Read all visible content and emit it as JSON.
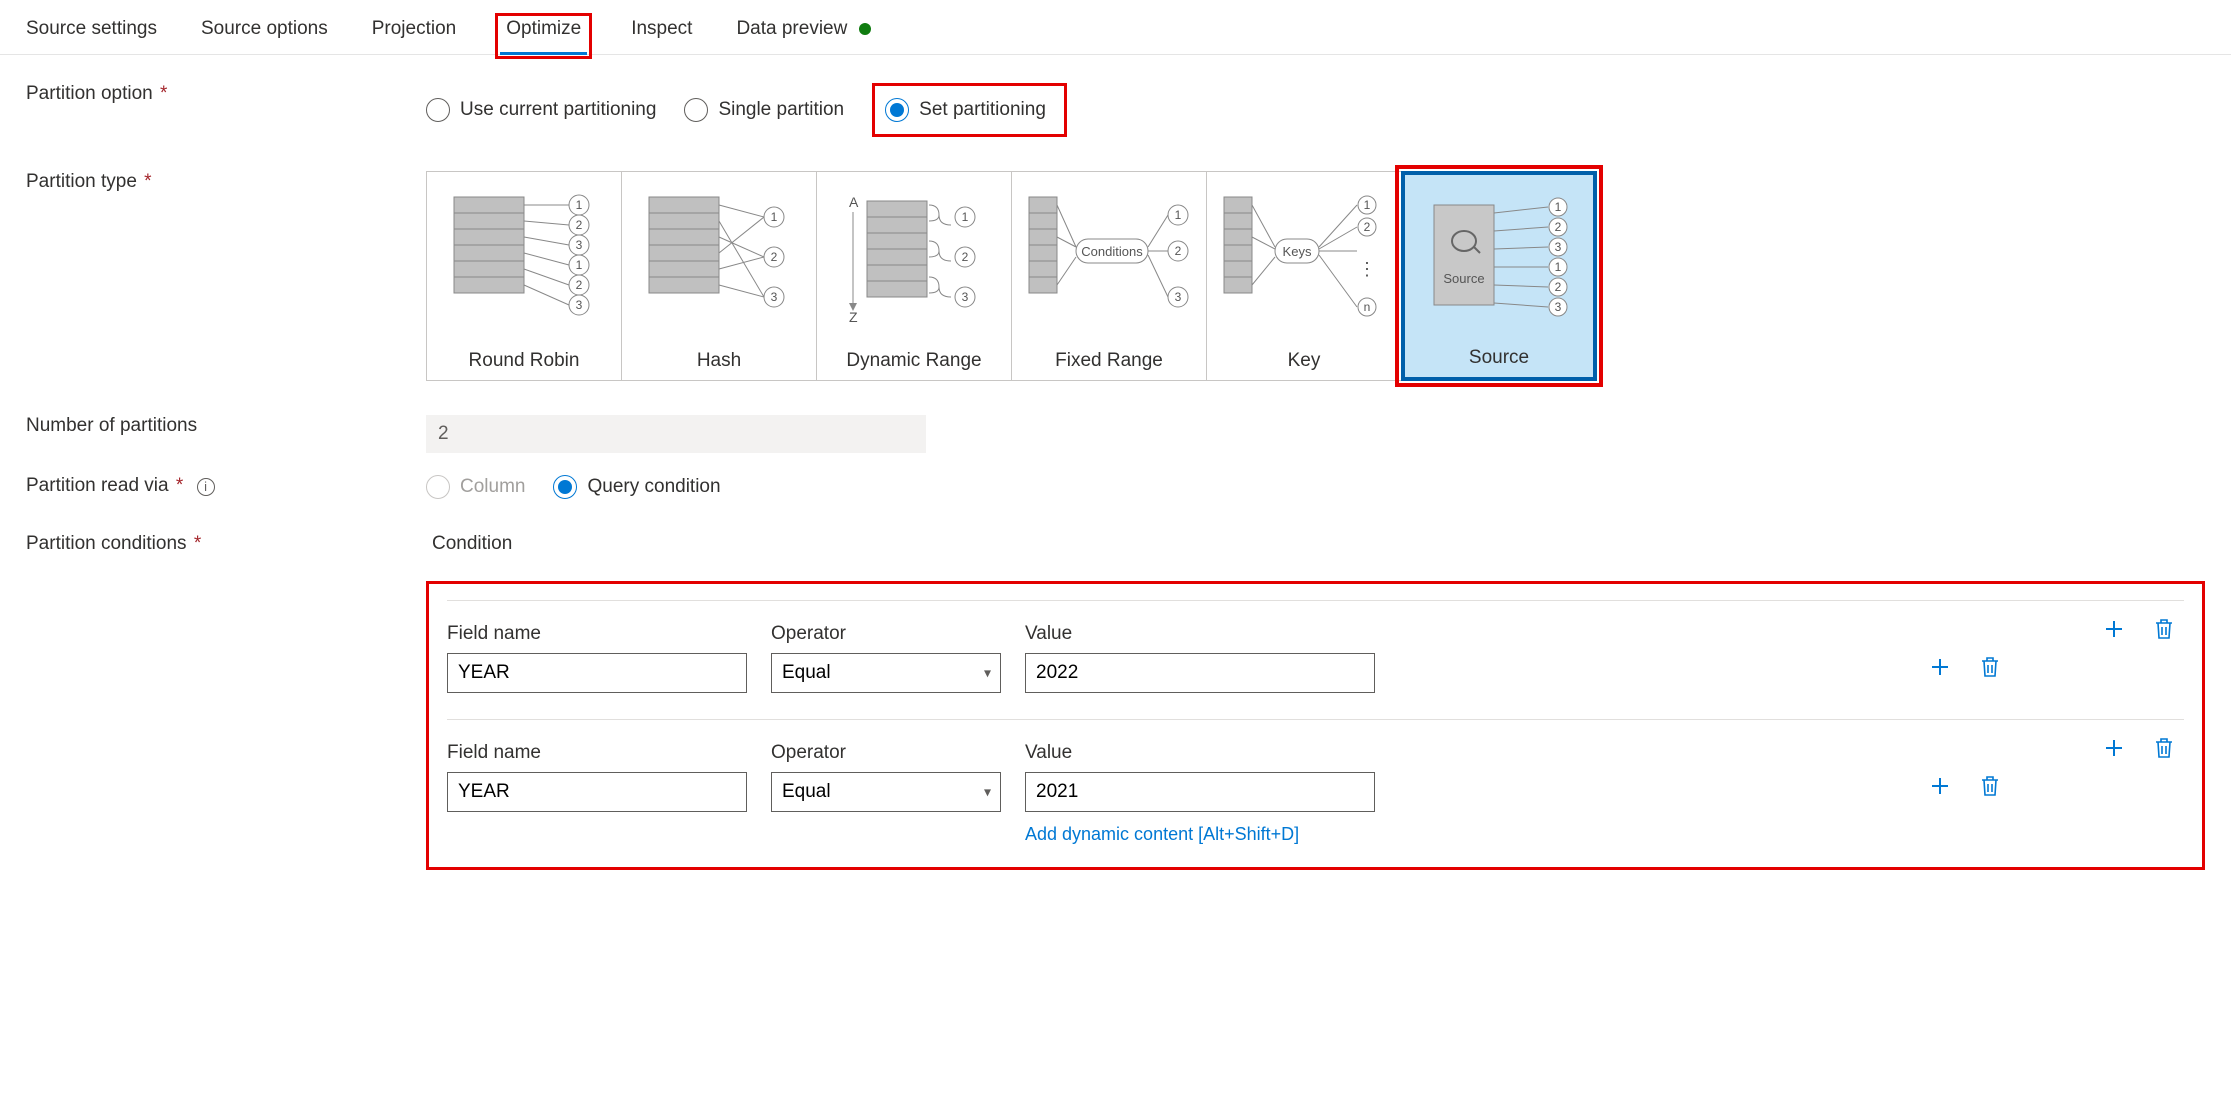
{
  "tabs": {
    "source_settings": "Source settings",
    "source_options": "Source options",
    "projection": "Projection",
    "optimize": "Optimize",
    "inspect": "Inspect",
    "data_preview": "Data preview"
  },
  "labels": {
    "partition_option": "Partition option",
    "partition_type": "Partition type",
    "number_of_partitions": "Number of partitions",
    "partition_read_via": "Partition read via",
    "partition_conditions": "Partition conditions",
    "condition": "Condition",
    "field_name": "Field name",
    "operator": "Operator",
    "value": "Value"
  },
  "partition_option_radios": {
    "use_current": "Use current partitioning",
    "single": "Single partition",
    "set": "Set partitioning"
  },
  "partition_types": {
    "round_robin": "Round Robin",
    "hash": "Hash",
    "dynamic_range": "Dynamic Range",
    "fixed_range": "Fixed Range",
    "key": "Key",
    "source": "Source"
  },
  "number_of_partitions_value": "2",
  "partition_read_via_radios": {
    "column": "Column",
    "query_condition": "Query condition"
  },
  "conditions": [
    {
      "field_name": "YEAR",
      "operator": "Equal",
      "value": "2022"
    },
    {
      "field_name": "YEAR",
      "operator": "Equal",
      "value": "2021"
    }
  ],
  "add_dynamic_content": "Add dynamic content [Alt+Shift+D]"
}
